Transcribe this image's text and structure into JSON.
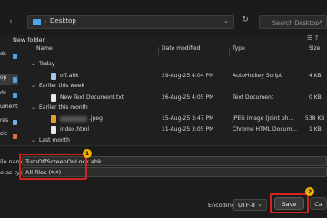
{
  "address_bar": {
    "path": "Desktop",
    "separator": "›",
    "dropdown_glyph": "⌄"
  },
  "search": {
    "placeholder": "Search Desktop"
  },
  "toolbar": {
    "new_folder": "New folder"
  },
  "sidebar": {
    "items": [
      {
        "label": "ds"
      },
      {
        "label": "op",
        "selected": true
      },
      {
        "label": "ds"
      },
      {
        "label": "uments"
      },
      {
        "label": "res"
      },
      {
        "label": "sic"
      },
      {
        "label": "os"
      }
    ]
  },
  "columns": {
    "name": "Name",
    "date": "Date modified",
    "type": "Type",
    "size": "Size"
  },
  "groups": {
    "today": "Today",
    "earlier_week": "Earlier this week",
    "earlier_month": "Earlier this month",
    "last_month": "Last month"
  },
  "files": [
    {
      "name": "off.ahk",
      "date": "29-Aug-25 4:04 PM",
      "type": "AutoHotkey Script",
      "size": "4 KB",
      "icon_color": "#9ec9ee"
    },
    {
      "name": "New Text Document.txt",
      "date": "26-Aug-25 4:05 PM",
      "type": "Text Document",
      "size": "0 KB",
      "icon_color": "#e8e8e8"
    },
    {
      "name": ".jpeg",
      "date": "15-Aug-25 3:47 PM",
      "type": "JPEG image (Joint ph...",
      "size": "538 KB",
      "icon_color": "#e0a030"
    },
    {
      "name": "index.html",
      "date": "11-Aug-25 3:05 PM",
      "type": "Chrome HTML Docum...",
      "size": "1 KB",
      "icon_color": "#e8e8e8"
    }
  ],
  "save_form": {
    "file_name_label": "ile name:",
    "file_name_value": "TurnOffScreenOnLock.ahk",
    "save_as_type_label": "e as type:",
    "save_as_type_value": "All files (*.*)",
    "encoding_label": "Encoding:",
    "encoding_value": "UTF-8",
    "save_button": "Save",
    "cancel_button": "Ca"
  },
  "annotations": {
    "badge_1": "1",
    "badge_2": "2",
    "highlight_color": "#d32424",
    "badge_color": "#f0b400"
  }
}
